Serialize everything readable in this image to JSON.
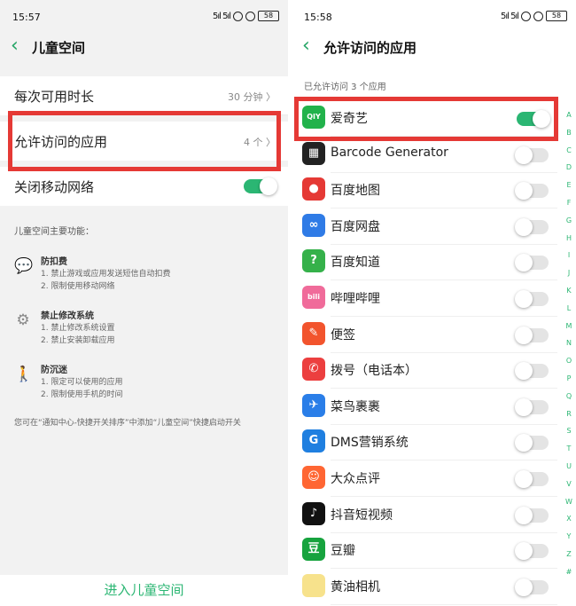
{
  "left": {
    "status": {
      "time": "15:57",
      "signal": "5ıl 5ıl",
      "battery": "58"
    },
    "nav": {
      "title": "儿童空间"
    },
    "rows": [
      {
        "label": "每次可用时长",
        "value": "30 分钟 〉"
      },
      {
        "label": "允许访问的应用",
        "value": "4 个 〉"
      }
    ],
    "network": {
      "label": "关闭移动网络",
      "toggle_on": true
    },
    "info": {
      "heading": "儿童空间主要功能：",
      "features": [
        {
          "icon": "chat-icon",
          "glyph": "💬",
          "title": "防扣费",
          "lines": [
            "1. 禁止游戏或应用发送短信自动扣费",
            "2. 限制使用移动网络"
          ]
        },
        {
          "icon": "gear-icon",
          "glyph": "⚙",
          "title": "禁止修改系统",
          "lines": [
            "1. 禁止修改系统设置",
            "2. 禁止安装卸载应用"
          ]
        },
        {
          "icon": "child-icon",
          "glyph": "🚶",
          "title": "防沉迷",
          "lines": [
            "1. 限定可以使用的应用",
            "2. 限制使用手机的时间"
          ]
        }
      ],
      "footer": "您可在“通知中心-快捷开关排序”中添加“儿童空间”快捷启动开关"
    },
    "enter_button": "进入儿童空间"
  },
  "right": {
    "status": {
      "time": "15:58",
      "signal": "5ıl 5ıl",
      "battery": "58"
    },
    "nav": {
      "title": "允许访问的应用"
    },
    "subheading": "已允许访问 3 个应用",
    "apps": [
      {
        "name": "爱奇艺",
        "icon": "iqiyi-icon",
        "glyph": "QIY",
        "color": "#21b24b",
        "on": true
      },
      {
        "name": "Barcode Generator",
        "icon": "barcode-icon",
        "glyph": "▦",
        "color": "#222222",
        "on": false
      },
      {
        "name": "百度地图",
        "icon": "map-pin-icon",
        "glyph": "●",
        "color": "#e53935",
        "on": false
      },
      {
        "name": "百度网盘",
        "icon": "cloud-icon",
        "glyph": "∞",
        "color": "#2f7be6",
        "on": false
      },
      {
        "name": "百度知道",
        "icon": "question-icon",
        "glyph": "?",
        "color": "#35b14a",
        "on": false
      },
      {
        "name": "哔哩哔哩",
        "icon": "bilibili-icon",
        "glyph": "bili",
        "color": "#f06b9a",
        "on": false
      },
      {
        "name": "便签",
        "icon": "pencil-icon",
        "glyph": "✎",
        "color": "#f2542d",
        "on": false
      },
      {
        "name": "拨号（电话本）",
        "icon": "phone-icon",
        "glyph": "✆",
        "color": "#ec3f3f",
        "on": false
      },
      {
        "name": "菜鸟裹裹",
        "icon": "bird-icon",
        "glyph": "✈",
        "color": "#2a7ee8",
        "on": false
      },
      {
        "name": "DMS营销系统",
        "icon": "dms-icon",
        "glyph": "G",
        "color": "#1f7fe0",
        "on": false
      },
      {
        "name": "大众点评",
        "icon": "dianping-icon",
        "glyph": "☺",
        "color": "#ff6633",
        "on": false
      },
      {
        "name": "抖音短视频",
        "icon": "douyin-icon",
        "glyph": "♪",
        "color": "#111111",
        "on": false
      },
      {
        "name": "豆瓣",
        "icon": "douban-icon",
        "glyph": "豆",
        "color": "#17a33e",
        "on": false
      },
      {
        "name": "黄油相机",
        "icon": "camera-icon",
        "glyph": "",
        "color": "#f7e28c",
        "on": false
      }
    ],
    "index_letters": [
      "A",
      "B",
      "C",
      "D",
      "E",
      "F",
      "G",
      "H",
      "I",
      "J",
      "K",
      "L",
      "M",
      "N",
      "O",
      "P",
      "Q",
      "R",
      "S",
      "T",
      "U",
      "V",
      "W",
      "X",
      "Y",
      "Z",
      "#"
    ]
  },
  "colors": {
    "accent": "#2bb673",
    "highlight": "#e53935"
  }
}
